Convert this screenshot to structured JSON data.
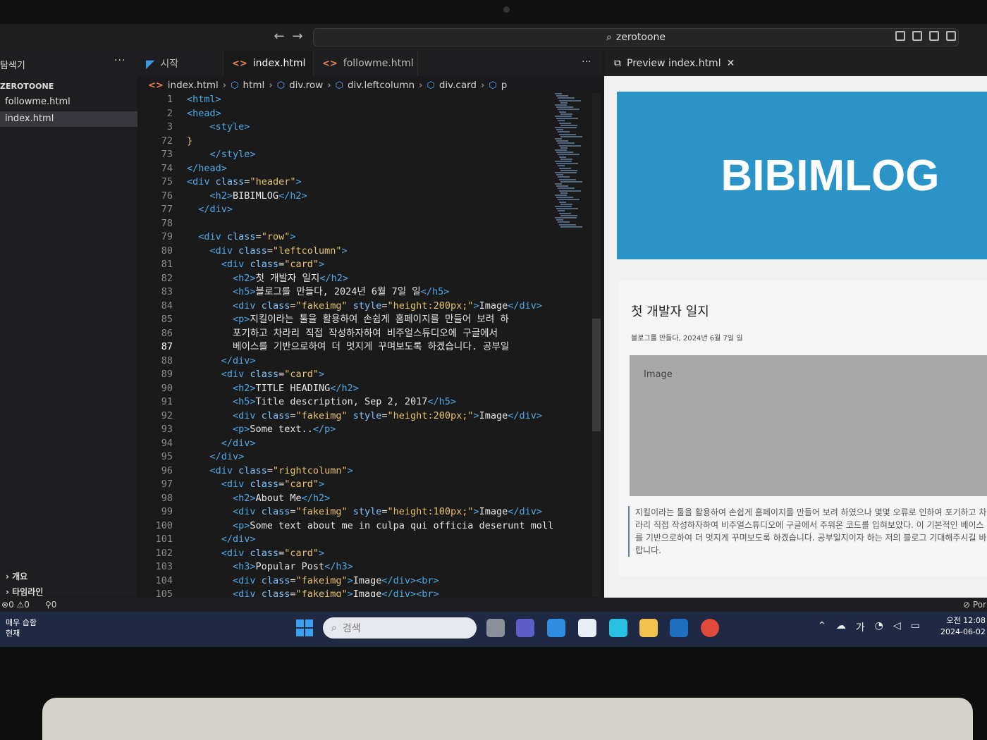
{
  "window": {
    "search_text": "zerotoone"
  },
  "sidebar": {
    "title": "탐색기",
    "folder": "ZEROTOONE",
    "files": [
      "followme.html",
      "index.html"
    ],
    "sections": [
      "개요",
      "타임라인"
    ]
  },
  "tabs": [
    {
      "label": "시작",
      "icon": "vscode-icon"
    },
    {
      "label": "index.html",
      "icon": "html-icon",
      "modified": true
    },
    {
      "label": "followme.html",
      "icon": "html-icon"
    }
  ],
  "preview_tab": {
    "label": "Preview index.html"
  },
  "breadcrumb": [
    "index.html",
    "html",
    "div.row",
    "div.leftcolumn",
    "div.card",
    "p"
  ],
  "code_lines": [
    {
      "n": "1",
      "html": "<span class='tag'>&lt;html&gt;</span>"
    },
    {
      "n": "2",
      "html": "<span class='tag'>&lt;head&gt;</span>"
    },
    {
      "n": "3",
      "html": "    <span class='tag'>&lt;style&gt;</span>"
    },
    {
      "n": "72",
      "html": "<span class='str'>}</span>"
    },
    {
      "n": "73",
      "html": "    <span class='tag'>&lt;/style&gt;</span>"
    },
    {
      "n": "74",
      "html": "<span class='tag'>&lt;/head&gt;</span>"
    },
    {
      "n": "75",
      "html": "<span class='tag'>&lt;div</span> <span class='attr'>class</span>=<span class='str'>\"header\"</span><span class='tag'>&gt;</span>"
    },
    {
      "n": "76",
      "html": "    <span class='tag'>&lt;h2&gt;</span>BIBIMLOG<span class='tag'>&lt;/h2&gt;</span>"
    },
    {
      "n": "77",
      "html": "  <span class='tag'>&lt;/div&gt;</span>"
    },
    {
      "n": "78",
      "html": ""
    },
    {
      "n": "79",
      "html": "  <span class='tag'>&lt;div</span> <span class='attr'>class</span>=<span class='str'>\"row\"</span><span class='tag'>&gt;</span>"
    },
    {
      "n": "80",
      "html": "    <span class='tag'>&lt;div</span> <span class='attr'>class</span>=<span class='str'>\"leftcolumn\"</span><span class='tag'>&gt;</span>"
    },
    {
      "n": "81",
      "html": "      <span class='tag'>&lt;div</span> <span class='attr'>class</span>=<span class='str'>\"card\"</span><span class='tag'>&gt;</span>"
    },
    {
      "n": "82",
      "html": "        <span class='tag'>&lt;h2&gt;</span>첫 개발자 일지<span class='tag'>&lt;/h2&gt;</span>"
    },
    {
      "n": "83",
      "html": "        <span class='tag'>&lt;h5&gt;</span>블로그를 만들다, 2024년 6월 7일 일<span class='tag'>&lt;/h5&gt;</span>"
    },
    {
      "n": "84",
      "html": "        <span class='tag'>&lt;div</span> <span class='attr'>class</span>=<span class='str'>\"fakeimg\"</span> <span class='attr'>style</span>=<span class='str'>\"height:200px;\"</span><span class='tag'>&gt;</span>Image<span class='tag'>&lt;/div&gt;</span>"
    },
    {
      "n": "85",
      "html": "        <span class='tag'>&lt;p&gt;</span>지킬이라는 툴을 활용하여 손쉽게 홈페이지를 만들어 보려 하"
    },
    {
      "n": "86",
      "html": "        포기하고 차라리 직접 작성하자하여 비주얼스튜디오에 구글에서"
    },
    {
      "n": "87",
      "html": "        베이스를 기반으로하여 더 멋지게 꾸며보도록 하겠습니다. 공부일"
    },
    {
      "n": "88",
      "html": "      <span class='tag'>&lt;/div&gt;</span>"
    },
    {
      "n": "89",
      "html": "      <span class='tag'>&lt;div</span> <span class='attr'>class</span>=<span class='str'>\"card\"</span><span class='tag'>&gt;</span>"
    },
    {
      "n": "90",
      "html": "        <span class='tag'>&lt;h2&gt;</span>TITLE HEADING<span class='tag'>&lt;/h2&gt;</span>"
    },
    {
      "n": "91",
      "html": "        <span class='tag'>&lt;h5&gt;</span>Title description, Sep 2, 2017<span class='tag'>&lt;/h5&gt;</span>"
    },
    {
      "n": "92",
      "html": "        <span class='tag'>&lt;div</span> <span class='attr'>class</span>=<span class='str'>\"fakeimg\"</span> <span class='attr'>style</span>=<span class='str'>\"height:200px;\"</span><span class='tag'>&gt;</span>Image<span class='tag'>&lt;/div&gt;</span>"
    },
    {
      "n": "93",
      "html": "        <span class='tag'>&lt;p&gt;</span>Some text..<span class='tag'>&lt;/p&gt;</span>"
    },
    {
      "n": "94",
      "html": "      <span class='tag'>&lt;/div&gt;</span>"
    },
    {
      "n": "95",
      "html": "    <span class='tag'>&lt;/div&gt;</span>"
    },
    {
      "n": "96",
      "html": "    <span class='tag'>&lt;div</span> <span class='attr'>class</span>=<span class='str'>\"rightcolumn\"</span><span class='tag'>&gt;</span>"
    },
    {
      "n": "97",
      "html": "      <span class='tag'>&lt;div</span> <span class='attr'>class</span>=<span class='str'>\"card\"</span><span class='tag'>&gt;</span>"
    },
    {
      "n": "98",
      "html": "        <span class='tag'>&lt;h2&gt;</span>About Me<span class='tag'>&lt;/h2&gt;</span>"
    },
    {
      "n": "99",
      "html": "        <span class='tag'>&lt;div</span> <span class='attr'>class</span>=<span class='str'>\"fakeimg\"</span> <span class='attr'>style</span>=<span class='str'>\"height:100px;\"</span><span class='tag'>&gt;</span>Image<span class='tag'>&lt;/div&gt;</span>"
    },
    {
      "n": "100",
      "html": "        <span class='tag'>&lt;p&gt;</span>Some text about me in culpa qui officia deserunt moll"
    },
    {
      "n": "101",
      "html": "      <span class='tag'>&lt;/div&gt;</span>"
    },
    {
      "n": "102",
      "html": "      <span class='tag'>&lt;div</span> <span class='attr'>class</span>=<span class='str'>\"card\"</span><span class='tag'>&gt;</span>"
    },
    {
      "n": "103",
      "html": "        <span class='tag'>&lt;h3&gt;</span>Popular Post<span class='tag'>&lt;/h3&gt;</span>"
    },
    {
      "n": "104",
      "html": "        <span class='tag'>&lt;div</span> <span class='attr'>class</span>=<span class='str'>\"fakeimg\"</span><span class='tag'>&gt;</span>Image<span class='tag'>&lt;/div&gt;&lt;br&gt;</span>"
    },
    {
      "n": "105",
      "html": "        <span class='tag'>&lt;div</span> <span class='attr'>class</span>=<span class='str'>\"fakeimg\"</span><span class='tag'>&gt;</span>Image<span class='tag'>&lt;/div&gt;&lt;br&gt;</span>"
    }
  ],
  "current_line": "87",
  "preview": {
    "header_title": "BIBIMLOG",
    "card_title": "첫 개발자 일지",
    "card_subtitle": "블로그를 만들다, 2024년 6월 7일 일",
    "image_label": "Image",
    "paragraph": "지킬이라는 툴을 활용하여 손쉽게 홈페이지를 만들어 보려 하였으나 몇몇 오류로 인하여 포기하고 차라리 직접 작성하자하여 비주얼스튜디오에 구글에서 주워온 코드를 입혀보았다. 이 기본적인 베이스를 기반으로하여 더 멋지게 꾸며보도록 하겠습니다. 공부일지이자 하는 저의 블로그 기대해주시길 바랍니다."
  },
  "statusbar": {
    "errors": "0",
    "warnings": "0",
    "ports": "0",
    "right_text": "Por"
  },
  "taskbar": {
    "weather_line1": "매우 습함",
    "weather_line2": "현재",
    "search_placeholder": "검색",
    "ime": "가",
    "time": "오전 12:08",
    "date": "2024-06-02"
  },
  "colors": {
    "accent": "#2a94c8",
    "vscode_blue": "#3b9be6",
    "html_orange": "#e8834e",
    "taskbar": "#202944"
  }
}
